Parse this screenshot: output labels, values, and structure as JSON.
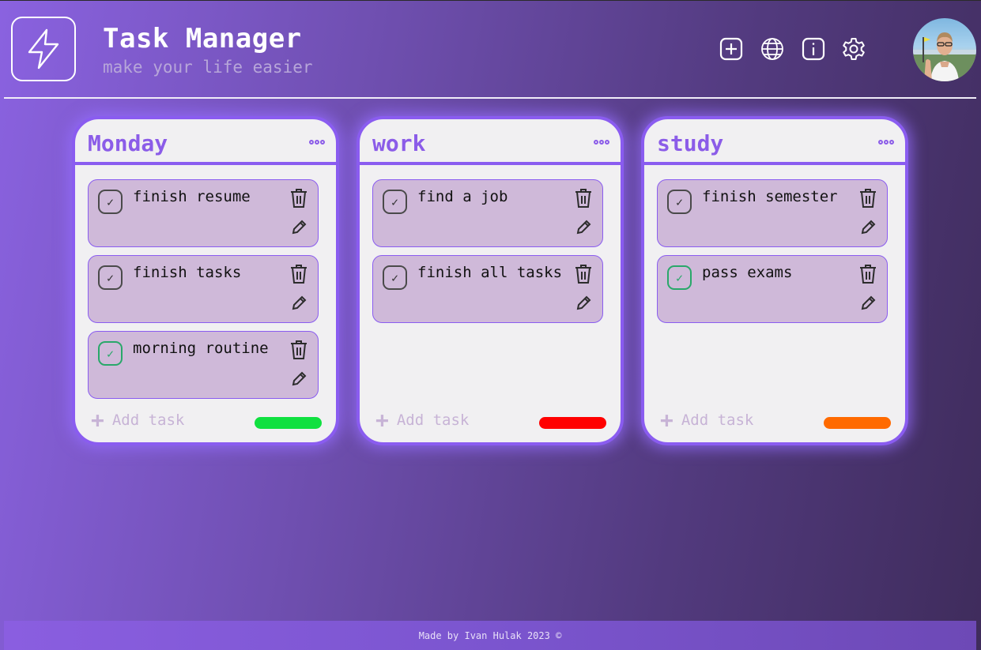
{
  "header": {
    "title": "Task Manager",
    "subtitle": "make your life easier",
    "icons": [
      "lightning-icon",
      "add-icon",
      "globe-icon",
      "info-icon",
      "settings-icon"
    ]
  },
  "boards": [
    {
      "title": "Monday",
      "priority_color": "#10e040",
      "add_label": "Add task",
      "tasks": [
        {
          "text": "finish resume",
          "done": false
        },
        {
          "text": "finish tasks",
          "done": false
        },
        {
          "text": "morning routine",
          "done": true
        }
      ]
    },
    {
      "title": "work",
      "priority_color": "#ff0000",
      "add_label": "Add task",
      "tasks": [
        {
          "text": "find a job",
          "done": false
        },
        {
          "text": "finish all tasks",
          "done": false
        }
      ]
    },
    {
      "title": "study",
      "priority_color": "#ff6a00",
      "add_label": "Add task",
      "tasks": [
        {
          "text": "finish semester",
          "done": false
        },
        {
          "text": "pass exams",
          "done": true
        }
      ]
    }
  ],
  "footer": {
    "text": "Made by Ivan Hulak 2023 ©"
  },
  "colors": {
    "accent": "#8a5cf0",
    "task_bg": "#cfb9d9",
    "board_bg": "#f1f0f2"
  }
}
